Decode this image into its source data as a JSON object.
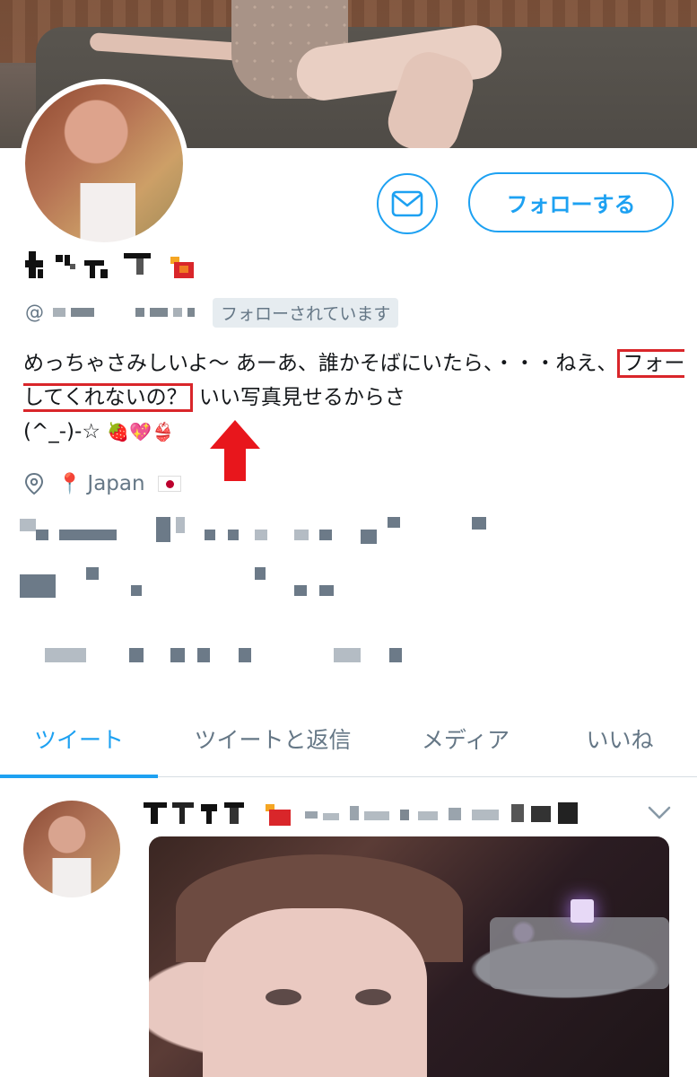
{
  "profile": {
    "follow_label": "フォローする",
    "handle_prefix": "@",
    "follows_you_label": "フォローされています",
    "bio_part1": "めっちゃさみしいよ〜 あーあ、誰かそばにいたら、・・・ねえ、",
    "bio_highlight": "フォーしてくれないの？",
    "bio_part2": " いい写真見せるからさ",
    "bio_part3": "(^_-)-☆ ",
    "bio_emojis": "🍓💖👙",
    "location_pin": "📍",
    "location_text": "Japan"
  },
  "tabs": [
    {
      "label": "ツイート",
      "active": true
    },
    {
      "label": "ツイートと返信",
      "active": false
    },
    {
      "label": "メディア",
      "active": false
    },
    {
      "label": "いいね",
      "active": false
    }
  ],
  "colors": {
    "accent": "#1da1f2",
    "highlight_border": "#d9262a",
    "muted_text": "#657786"
  },
  "icons": {
    "message": "envelope-icon",
    "location": "location-pin-icon",
    "tweet_menu": "chevron-down-icon",
    "annotation": "red-arrow-up"
  }
}
